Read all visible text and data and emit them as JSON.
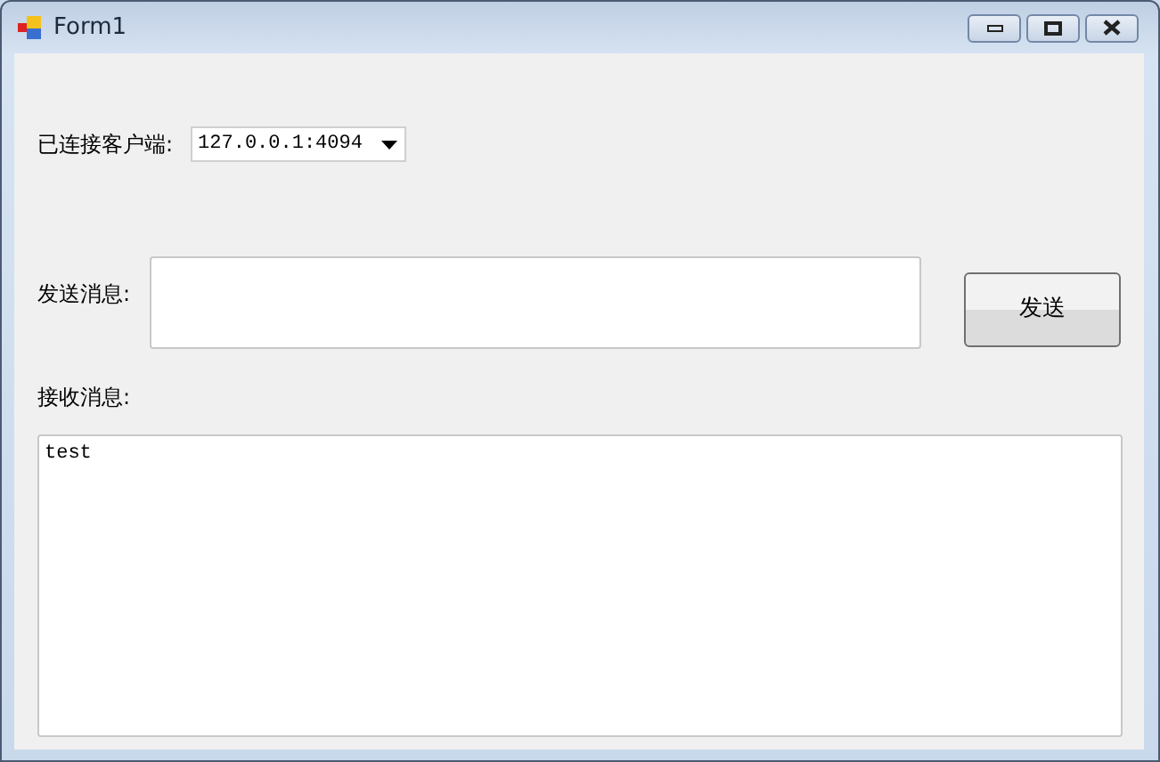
{
  "window": {
    "title": "Form1"
  },
  "client": {
    "label": "已连接客户端:",
    "value": "127.0.0.1:4094"
  },
  "send": {
    "label": "发送消息:",
    "button": "发送"
  },
  "receive": {
    "label": "接收消息:",
    "value": "test"
  }
}
